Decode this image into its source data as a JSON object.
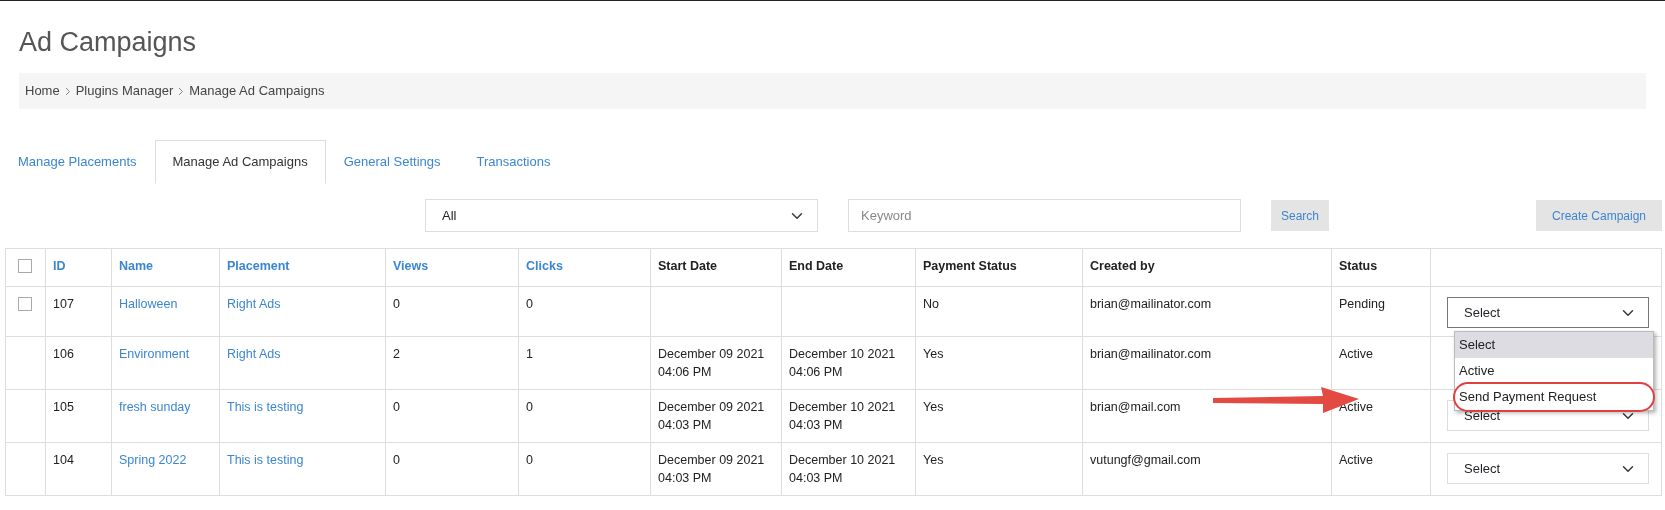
{
  "page_title": "Ad Campaigns",
  "breadcrumb": [
    "Home",
    "Plugins Manager",
    "Manage Ad Campaigns"
  ],
  "tabs": [
    {
      "label": "Manage Placements",
      "selected": false
    },
    {
      "label": "Manage Ad Campaigns",
      "selected": true
    },
    {
      "label": "General Settings",
      "selected": false
    },
    {
      "label": "Transactions",
      "selected": false
    }
  ],
  "filter": {
    "status_select": "All",
    "keyword_placeholder": "Keyword",
    "search_button": "Search",
    "create_button": "Create Campaign"
  },
  "table": {
    "select_all_checked": false,
    "columns": [
      {
        "label": "ID",
        "sortable": true
      },
      {
        "label": "Name",
        "sortable": true
      },
      {
        "label": "Placement",
        "sortable": true
      },
      {
        "label": "Views",
        "sortable": true
      },
      {
        "label": "Clicks",
        "sortable": true
      },
      {
        "label": "Start Date",
        "sortable": false
      },
      {
        "label": "End Date",
        "sortable": false
      },
      {
        "label": "Payment Status",
        "sortable": false
      },
      {
        "label": "Created by",
        "sortable": false
      },
      {
        "label": "Status",
        "sortable": false
      }
    ],
    "rows": [
      {
        "checked": false,
        "id": "107",
        "name": "Halloween",
        "placement": "Right Ads",
        "views": "0",
        "clicks": "0",
        "payment_status": "No",
        "created_by": "brian@mailinator.com",
        "status": "Pending",
        "action": "Select",
        "open_menu": [
          {
            "label": "Select",
            "selected": true,
            "circled": false
          },
          {
            "label": "Active",
            "selected": false,
            "circled": false
          },
          {
            "label": "Send Payment Request",
            "selected": false,
            "circled": true
          }
        ]
      },
      {
        "id": "106",
        "name": "Environment",
        "placement": "Right Ads",
        "views": "2",
        "clicks": "1",
        "start_date": "December 09 2021 04:06 PM",
        "end_date": "December 10 2021 04:06 PM",
        "payment_status": "Yes",
        "created_by": "brian@mailinator.com",
        "status": "Active"
      },
      {
        "id": "105",
        "name": "fresh sunday",
        "placement": "This is testing",
        "views": "0",
        "clicks": "0",
        "start_date": "December 09 2021 04:03 PM",
        "end_date": "December 10 2021 04:03 PM",
        "payment_status": "Yes",
        "created_by": "brian@mail.com",
        "status": "Active",
        "action": "Select"
      },
      {
        "id": "104",
        "name": "Spring 2022",
        "placement": "This is testing",
        "views": "0",
        "clicks": "0",
        "start_date": "December 09 2021 04:03 PM",
        "end_date": "December 10 2021 04:03 PM",
        "payment_status": "Yes",
        "created_by": "vutungf@gmail.com",
        "status": "Active",
        "action": "Select"
      }
    ]
  }
}
